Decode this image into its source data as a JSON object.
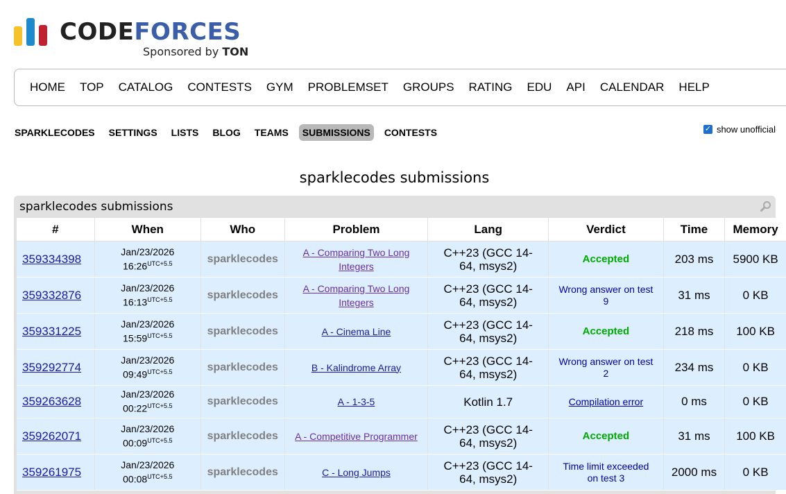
{
  "logo": {
    "word_code": "CODE",
    "word_forces": "FORCES",
    "sponsor_prefix": "Sponsored by ",
    "sponsor_name": "TON"
  },
  "main_menu": [
    "HOME",
    "TOP",
    "CATALOG",
    "CONTESTS",
    "GYM",
    "PROBLEMSET",
    "GROUPS",
    "RATING",
    "EDU",
    "API",
    "CALENDAR",
    "HELP"
  ],
  "sub_menu": {
    "items": [
      "SPARKLECODES",
      "SETTINGS",
      "LISTS",
      "BLOG",
      "TEAMS",
      "SUBMISSIONS",
      "CONTESTS"
    ],
    "active": "SUBMISSIONS"
  },
  "show_unofficial": {
    "label": "show unofficial",
    "checked": true
  },
  "page_title": "sparklecodes submissions",
  "panel_caption": "sparklecodes submissions",
  "table": {
    "headers": [
      "#",
      "When",
      "Who",
      "Problem",
      "Lang",
      "Verdict",
      "Time",
      "Memory"
    ],
    "rows": [
      {
        "id": "359334398",
        "date": "Jan/23/2026",
        "time": "16:26",
        "tz": "UTC+5.5",
        "who": "sparklecodes",
        "problem": "A - Comparing Two Long Integers",
        "lang": "C++23 (GCC 14-64, msys2)",
        "verdict": "Accepted",
        "vtype": "acc",
        "run": "203 ms",
        "mem": "5900 KB"
      },
      {
        "id": "359332876",
        "date": "Jan/23/2026",
        "time": "16:13",
        "tz": "UTC+5.5",
        "who": "sparklecodes",
        "problem": "A - Comparing Two Long Integers",
        "lang": "C++23 (GCC 14-64, msys2)",
        "verdict": "Wrong answer on test 9",
        "vtype": "wa",
        "run": "31 ms",
        "mem": "0 KB"
      },
      {
        "id": "359331225",
        "date": "Jan/23/2026",
        "time": "15:59",
        "tz": "UTC+5.5",
        "who": "sparklecodes",
        "problem": "A - Cinema Line",
        "lang": "C++23 (GCC 14-64, msys2)",
        "verdict": "Accepted",
        "vtype": "acc",
        "run": "218 ms",
        "mem": "100 KB"
      },
      {
        "id": "359292774",
        "date": "Jan/23/2026",
        "time": "09:49",
        "tz": "UTC+5.5",
        "who": "sparklecodes",
        "problem": "B - Kalindrome Array",
        "lang": "C++23 (GCC 14-64, msys2)",
        "verdict": "Wrong answer on test 2",
        "vtype": "wa",
        "run": "234 ms",
        "mem": "0 KB"
      },
      {
        "id": "359263628",
        "date": "Jan/23/2026",
        "time": "00:22",
        "tz": "UTC+5.5",
        "who": "sparklecodes",
        "problem": "A - 1-3-5",
        "lang": "Kotlin 1.7",
        "verdict": "Compilation error",
        "vtype": "ce",
        "run": "0 ms",
        "mem": "0 KB"
      },
      {
        "id": "359262071",
        "date": "Jan/23/2026",
        "time": "00:09",
        "tz": "UTC+5.5",
        "who": "sparklecodes",
        "problem": "A - Competitive Programmer",
        "lang": "C++23 (GCC 14-64, msys2)",
        "verdict": "Accepted",
        "vtype": "acc",
        "run": "31 ms",
        "mem": "100 KB"
      },
      {
        "id": "359261975",
        "date": "Jan/23/2026",
        "time": "00:08",
        "tz": "UTC+5.5",
        "who": "sparklecodes",
        "problem": "C - Long Jumps",
        "lang": "C++23 (GCC 14-64, msys2)",
        "verdict": "Time limit exceeded on test 3",
        "vtype": "wa",
        "run": "2000 ms",
        "mem": "0 KB"
      }
    ]
  },
  "colors": {
    "accepted": "#00aa00",
    "link": "#1a1aa6",
    "row_background": "#ddeeff"
  }
}
